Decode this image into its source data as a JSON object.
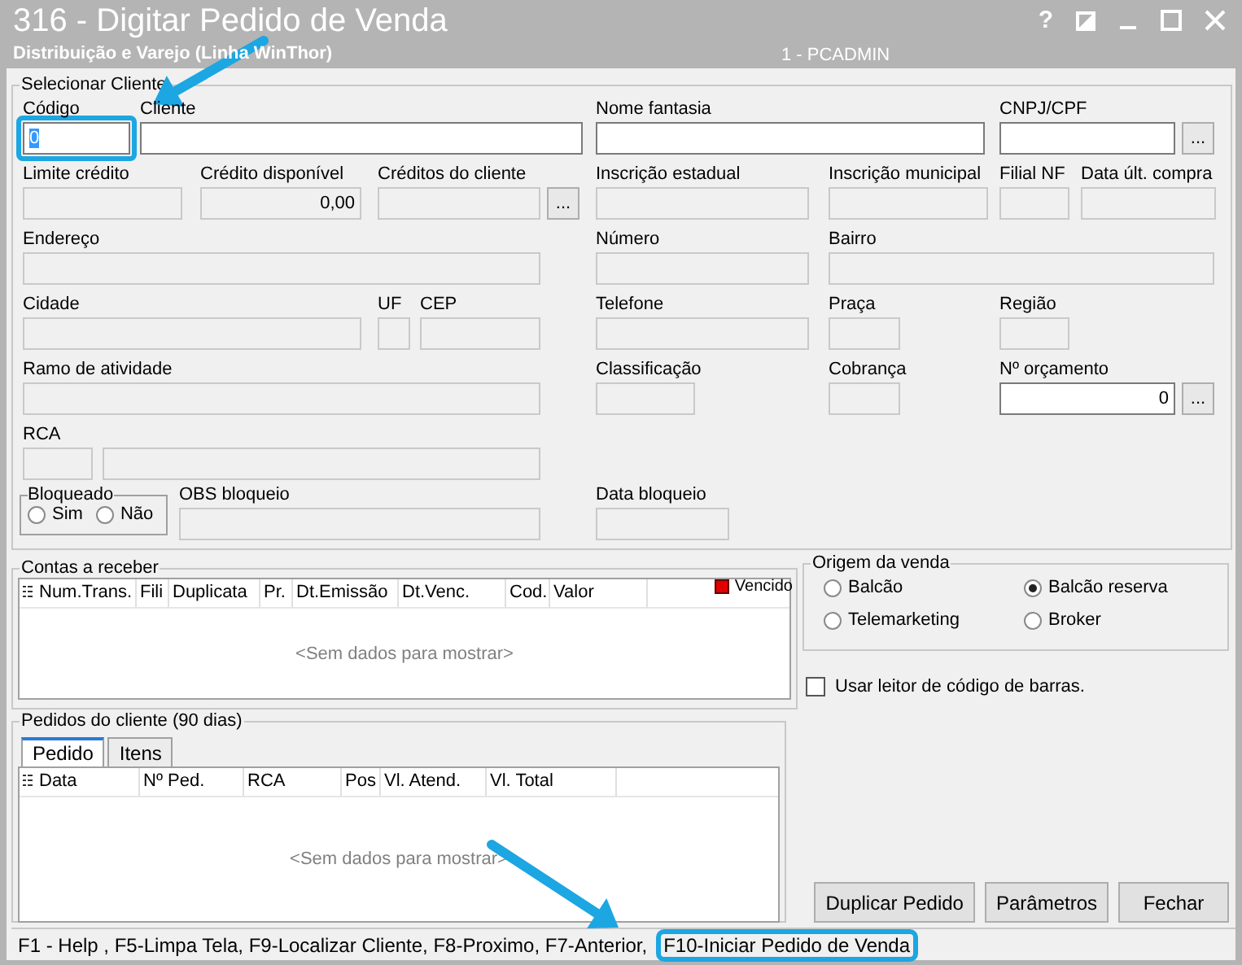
{
  "window": {
    "title": "316 - Digitar Pedido de Venda",
    "subtitle": "Distribuição e Varejo (Linha WinThor)",
    "user": "1 - PCADMIN",
    "help": "?"
  },
  "cliente": {
    "title": "Selecionar Cliente",
    "rows": [
      [
        {
          "kind": "field",
          "label": "Código",
          "value": "0",
          "editable": true,
          "value_selected": true,
          "highlighted": true
        },
        {
          "kind": "field",
          "label": "Cliente",
          "editable": true
        },
        {
          "kind": "field",
          "label": "Nome fantasia",
          "editable": true
        },
        {
          "kind": "field",
          "label": "CNPJ/CPF",
          "editable": true,
          "button": "..."
        }
      ],
      [
        {
          "kind": "field",
          "label": "Limite crédito",
          "editable": false
        },
        {
          "kind": "field",
          "label": "Crédito disponível",
          "value": "0,00",
          "numeric": true,
          "editable": false
        },
        {
          "kind": "field",
          "label": "Créditos do cliente",
          "editable": false,
          "button": "..."
        },
        {
          "kind": "field",
          "label": "Inscrição estadual",
          "editable": false
        },
        {
          "kind": "field",
          "label": "Inscrição municipal",
          "editable": false
        },
        {
          "kind": "field",
          "label": "Filial NF",
          "editable": false
        },
        {
          "kind": "field",
          "label": "Data últ. compra",
          "editable": false
        }
      ],
      [
        {
          "kind": "field",
          "label": "Endereço",
          "editable": false
        },
        {
          "kind": "field",
          "label": "Número",
          "editable": false
        },
        {
          "kind": "field",
          "label": "Bairro",
          "editable": false
        }
      ],
      [
        {
          "kind": "field",
          "label": "Cidade",
          "editable": false
        },
        {
          "kind": "field",
          "label": "UF",
          "editable": false
        },
        {
          "kind": "field",
          "label": "CEP",
          "editable": false
        },
        {
          "kind": "field",
          "label": "Telefone",
          "editable": false
        },
        {
          "kind": "field",
          "label": "Praça",
          "editable": false
        },
        {
          "kind": "field",
          "label": "Região",
          "editable": false
        }
      ],
      [
        {
          "kind": "field",
          "label": "Ramo de atividade",
          "editable": false
        },
        {
          "kind": "field",
          "label": "Classificação",
          "editable": false
        },
        {
          "kind": "field",
          "label": "Cobrança",
          "editable": false
        },
        {
          "kind": "field",
          "label": "Nº orçamento",
          "value": "0",
          "numeric": true,
          "editable": true,
          "button": "..."
        }
      ],
      [
        {
          "kind": "field",
          "label": "RCA",
          "editable": false
        },
        {
          "kind": "field",
          "editable": false
        }
      ],
      [
        {
          "kind": "radios",
          "label": "Bloqueado",
          "options": [
            {
              "label": "Sim",
              "selected": false
            },
            {
              "label": "Não",
              "selected": false
            }
          ]
        },
        {
          "kind": "field",
          "label": "OBS bloqueio",
          "editable": false
        },
        {
          "kind": "field",
          "label": "Data bloqueio",
          "editable": false
        }
      ]
    ]
  },
  "contas": {
    "title": "Contas a receber",
    "legend": "Vencido",
    "columns": [
      "Num.Trans.",
      "Fili",
      "Duplicata",
      "Pr.",
      "Dt.Emissão",
      "Dt.Venc.",
      "Cod.",
      "Valor"
    ],
    "empty": "<Sem dados para mostrar>"
  },
  "pedidos": {
    "title": "Pedidos do cliente (90 dias)",
    "tabs": [
      {
        "label": "Pedido",
        "selected": true
      },
      {
        "label": "Itens",
        "selected": false
      }
    ],
    "columns": [
      "Data",
      "Nº Ped.",
      "RCA",
      "Pos",
      "Vl. Atend.",
      "Vl. Total"
    ],
    "empty": "<Sem dados para mostrar>"
  },
  "origem": {
    "title": "Origem da venda",
    "options": [
      {
        "label": "Balcão",
        "selected": false
      },
      {
        "label": "Balcão reserva",
        "selected": true
      },
      {
        "label": "Telemarketing",
        "selected": false
      },
      {
        "label": "Broker",
        "selected": false
      }
    ]
  },
  "barcode": {
    "label": "Usar leitor de código de barras.",
    "checked": false
  },
  "buttons": [
    "Duplicar Pedido",
    "Parâmetros",
    "Fechar"
  ],
  "status_bar": [
    {
      "text": "F1 - Help , F5-Limpa Tela, F9-Localizar Cliente, F8-Proximo, F7-Anterior,",
      "highlighted": false
    },
    {
      "text": "F10-Iniciar Pedido de Venda",
      "highlighted": true
    }
  ]
}
